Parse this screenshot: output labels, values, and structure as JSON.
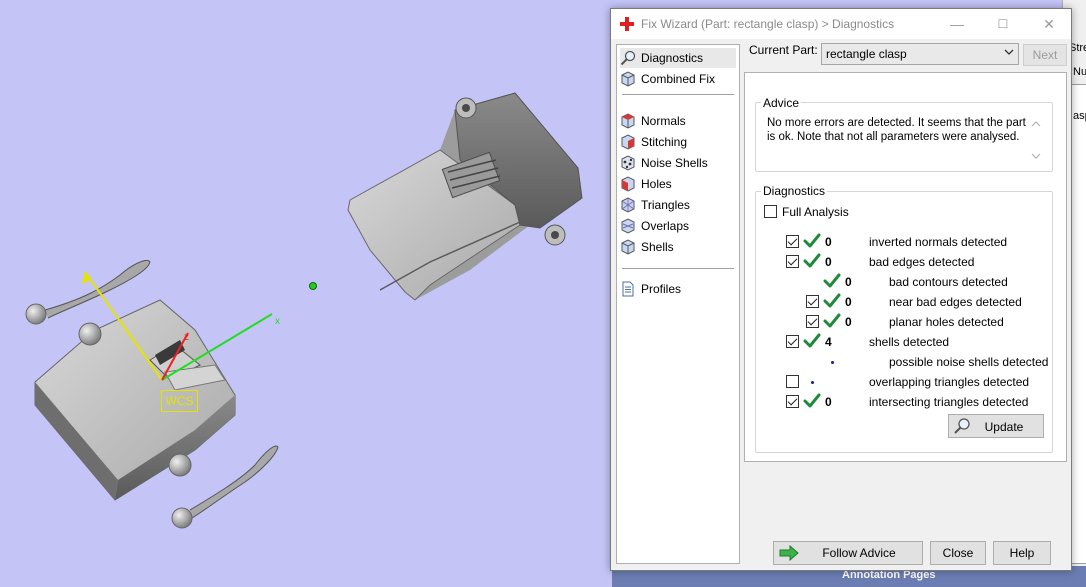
{
  "viewport": {
    "wcs_label": "WCS",
    "axis_x_label": "x",
    "axis_z_label": "z",
    "axis_x_color": "#22dd22",
    "axis_y_color": "#e4e400",
    "axis_z_color": "#ee2222",
    "background": "#c4c4f7"
  },
  "background_app": {
    "text1": "Stre",
    "text2": "Nu",
    "text3": "asp",
    "bottom_strip": "Annotation Pages"
  },
  "dialog": {
    "title": "Fix Wizard (Part: rectangle clasp) > Diagnostics",
    "controls": {
      "minimize": "—",
      "maximize": "☐",
      "close": "✕"
    },
    "nav": [
      {
        "label": "Diagnostics",
        "icon": "magnifier-icon",
        "selected": true
      },
      {
        "label": "Combined Fix",
        "icon": "cube-icon"
      },
      {
        "label": "Normals",
        "icon": "normals-cube-icon"
      },
      {
        "label": "Stitching",
        "icon": "stitching-cube-icon"
      },
      {
        "label": "Noise Shells",
        "icon": "noise-shells-icon"
      },
      {
        "label": "Holes",
        "icon": "holes-cube-icon"
      },
      {
        "label": "Triangles",
        "icon": "triangles-cube-icon"
      },
      {
        "label": "Overlaps",
        "icon": "overlaps-cube-icon"
      },
      {
        "label": "Shells",
        "icon": "shells-cube-icon"
      },
      {
        "label": "Profiles",
        "icon": "document-icon"
      }
    ],
    "current_part_label": "Current Part:",
    "current_part_value": "rectangle clasp",
    "next_label": "Next",
    "advice": {
      "title": "Advice",
      "text": "No more errors are detected. It seems that the part is ok. Note that not all parameters were analysed."
    },
    "diagnostics": {
      "title": "Diagnostics",
      "full_analysis_label": "Full Analysis",
      "full_analysis_checked": false,
      "rows": [
        {
          "label": "inverted normals detected",
          "checked": true,
          "has_checkbox": true,
          "status": "ok",
          "count": "0",
          "indent": 0
        },
        {
          "label": "bad edges detected",
          "checked": true,
          "has_checkbox": true,
          "status": "ok",
          "count": "0",
          "indent": 0
        },
        {
          "label": "bad contours detected",
          "checked": false,
          "has_checkbox": false,
          "status": "ok",
          "count": "0",
          "indent": 1
        },
        {
          "label": "near bad edges detected",
          "checked": true,
          "has_checkbox": true,
          "status": "ok",
          "count": "0",
          "indent": 1
        },
        {
          "label": "planar holes detected",
          "checked": true,
          "has_checkbox": true,
          "status": "ok",
          "count": "0",
          "indent": 1
        },
        {
          "label": "shells detected",
          "checked": true,
          "has_checkbox": true,
          "status": "ok",
          "count": "4",
          "indent": 0
        },
        {
          "label": "possible noise shells detected",
          "checked": false,
          "has_checkbox": false,
          "status": "dot",
          "count": "",
          "indent": 1
        },
        {
          "label": "overlapping triangles detected",
          "checked": false,
          "has_checkbox": true,
          "status": "dot",
          "count": "",
          "indent": 0
        },
        {
          "label": "intersecting triangles detected",
          "checked": true,
          "has_checkbox": true,
          "status": "ok",
          "count": "0",
          "indent": 0
        }
      ],
      "update_label": "Update"
    },
    "footer": {
      "follow_advice_label": "Follow Advice",
      "close_label": "Close",
      "help_label": "Help"
    },
    "colors": {
      "tick_green": "#1f8a3a",
      "arrow_green": "#3cb34a"
    }
  }
}
